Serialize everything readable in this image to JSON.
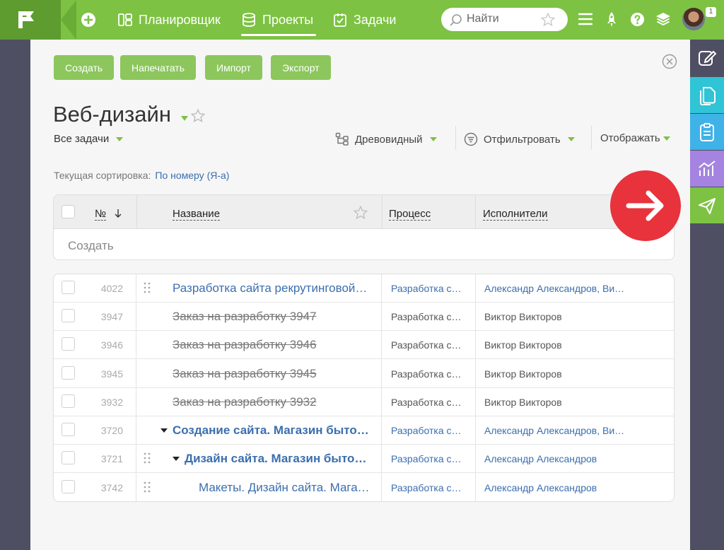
{
  "topbar": {
    "nav": [
      {
        "label": "Планировщик",
        "icon": "planner-icon"
      },
      {
        "label": "Проекты",
        "icon": "projects-icon",
        "active": true
      },
      {
        "label": "Задачи",
        "icon": "tasks-icon"
      }
    ],
    "search_placeholder": "Найти",
    "notification_count": "1"
  },
  "toolbar": {
    "create": "Создать",
    "print": "Напечатать",
    "import": "Импорт",
    "export": "Экспорт"
  },
  "project": {
    "title": "Веб-дизайн",
    "view": "Все задачи",
    "tree_mode": "Древовидный",
    "filter": "Отфильтровать",
    "display": "Отображать"
  },
  "sort": {
    "label": "Текущая сортировка:",
    "value": "По номеру (Я-а)"
  },
  "table": {
    "headers": {
      "number": "№",
      "name": "Название",
      "process": "Процесс",
      "executors": "Исполнители"
    },
    "create_row": "Создать",
    "rows": [
      {
        "id": "4022",
        "name": "Разработка сайта рекрутинговой компании",
        "process": "Разработка сайта",
        "executors": "Александр Александров, Виктор Викторов"
      },
      {
        "id": "3947",
        "name": "Заказ на разработку 3947",
        "process": "Разработка сайта",
        "executors": "Виктор Викторов"
      },
      {
        "id": "3946",
        "name": "Заказ на разработку 3946",
        "process": "Разработка сайта",
        "executors": "Виктор Викторов"
      },
      {
        "id": "3945",
        "name": "Заказ на разработку 3945",
        "process": "Разработка сайта",
        "executors": "Виктор Викторов"
      },
      {
        "id": "3932",
        "name": "Заказ на разработку 3932",
        "process": "Разработка сайта",
        "executors": "Виктор Викторов"
      },
      {
        "id": "3720",
        "name": "Создание сайта. Магазин бытовой техники",
        "process": "Разработка сайта",
        "executors": "Александр Александров, Виктор Викторов"
      },
      {
        "id": "3721",
        "name": "Дизайн сайта. Магазин бытовой техники",
        "process": "Разработка сайта",
        "executors": "Александр Александров"
      },
      {
        "id": "3742",
        "name": "Макеты. Дизайн сайта. Магазин бытовой техники",
        "process": "Разработка сайта",
        "executors": "Александр Александров"
      }
    ]
  },
  "colors": {
    "brand_green": "#7dc243",
    "button_green": "#8cc65c",
    "link_blue": "#3b6eaf",
    "fab_red": "#e8323c",
    "sidebar_bg": "#4e4f63"
  }
}
